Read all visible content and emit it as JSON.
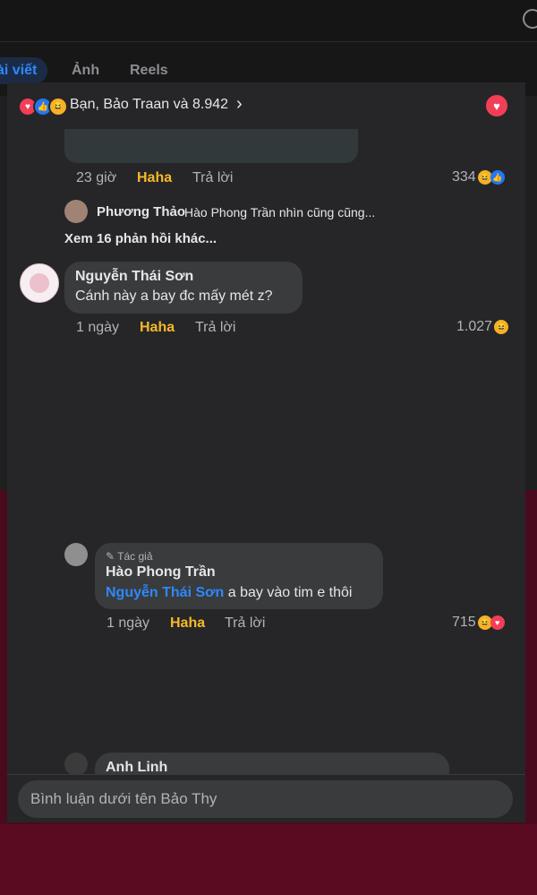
{
  "background": {
    "tabs": [
      "ài viết",
      "Ảnh",
      "Reels"
    ]
  },
  "reactions_bar": {
    "icons": [
      "love-reaction-icon",
      "like-reaction-icon",
      "haha-reaction-icon"
    ],
    "text": "Bạn, Bảo Traan và 8.942",
    "chevron": "›"
  },
  "comment_1": {
    "time": "23 giờ",
    "reaction_label": "Haha",
    "reply_label": "Trả lời",
    "count": "334",
    "reply_preview": {
      "name": "Phương Thảo",
      "text": "Hào Phong Trần nhìn cũng cũng..."
    },
    "more_replies": "Xem 16 phản hồi khác..."
  },
  "comment_2": {
    "name": "Nguyễn Thái Sơn",
    "text": "Cánh này a bay đc mấy mét z?",
    "time": "1 ngày",
    "reaction_label": "Haha",
    "reply_label": "Trả lời",
    "count": "1.027"
  },
  "comment_3": {
    "author_tag": "Tác giả",
    "name": "Hào Phong Trần",
    "mention": "Nguyễn Thái Sơn",
    "text": " a bay vào tim e thôi",
    "time": "1 ngày",
    "reaction_label": "Haha",
    "reply_label": "Trả lời",
    "count": "715"
  },
  "comment_4": {
    "name": "Anh Linh"
  },
  "comment_input": {
    "placeholder": "Bình luận dưới tên Bảo Thy"
  },
  "colors": {
    "accent": "#2d88ff",
    "haha": "#f7b928",
    "love": "#f33e58"
  }
}
